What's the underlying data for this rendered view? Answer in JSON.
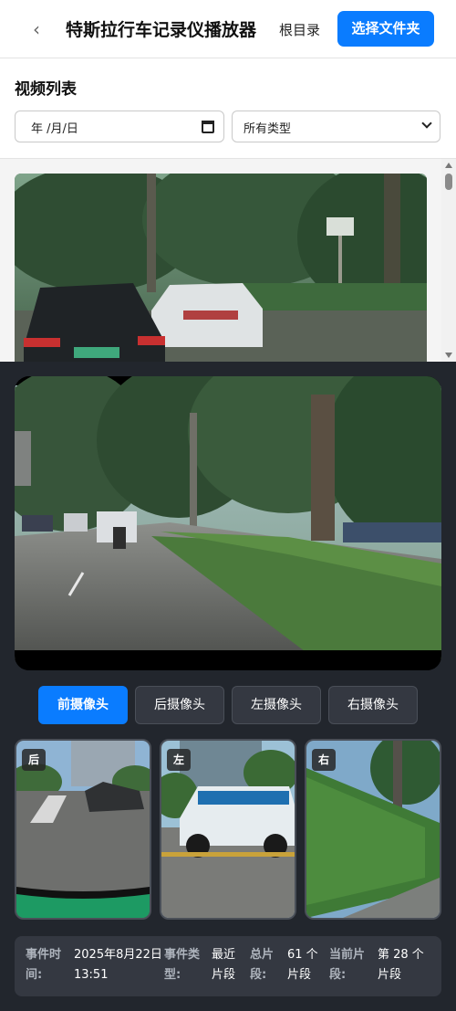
{
  "header": {
    "back_glyph": "‹",
    "title": "特斯拉行车记录仪播放器",
    "root_label": "根目录",
    "choose_folder_label": "选择文件夹"
  },
  "list": {
    "title": "视频列表",
    "date_placeholder": "年 /月/日",
    "type_selected": "所有类型"
  },
  "player": {
    "camera_buttons": [
      "前摄像头",
      "后摄像头",
      "左摄像头",
      "右摄像头"
    ],
    "active_camera": "前摄像头",
    "sub_views": [
      {
        "label": "后"
      },
      {
        "label": "左"
      },
      {
        "label": "右"
      }
    ]
  },
  "info": {
    "event_time_label": "事件时间:",
    "event_time_value": "2025年8月22日 13:51",
    "event_type_label": "事件类型:",
    "event_type_value": "最近片段",
    "total_label": "总片段:",
    "total_value": "61 个片段",
    "current_label": "当前片段:",
    "current_value": "第 28 个片段"
  },
  "colors": {
    "accent": "#0a7cff",
    "player_bg": "#22262d",
    "panel_bg": "#343841"
  }
}
